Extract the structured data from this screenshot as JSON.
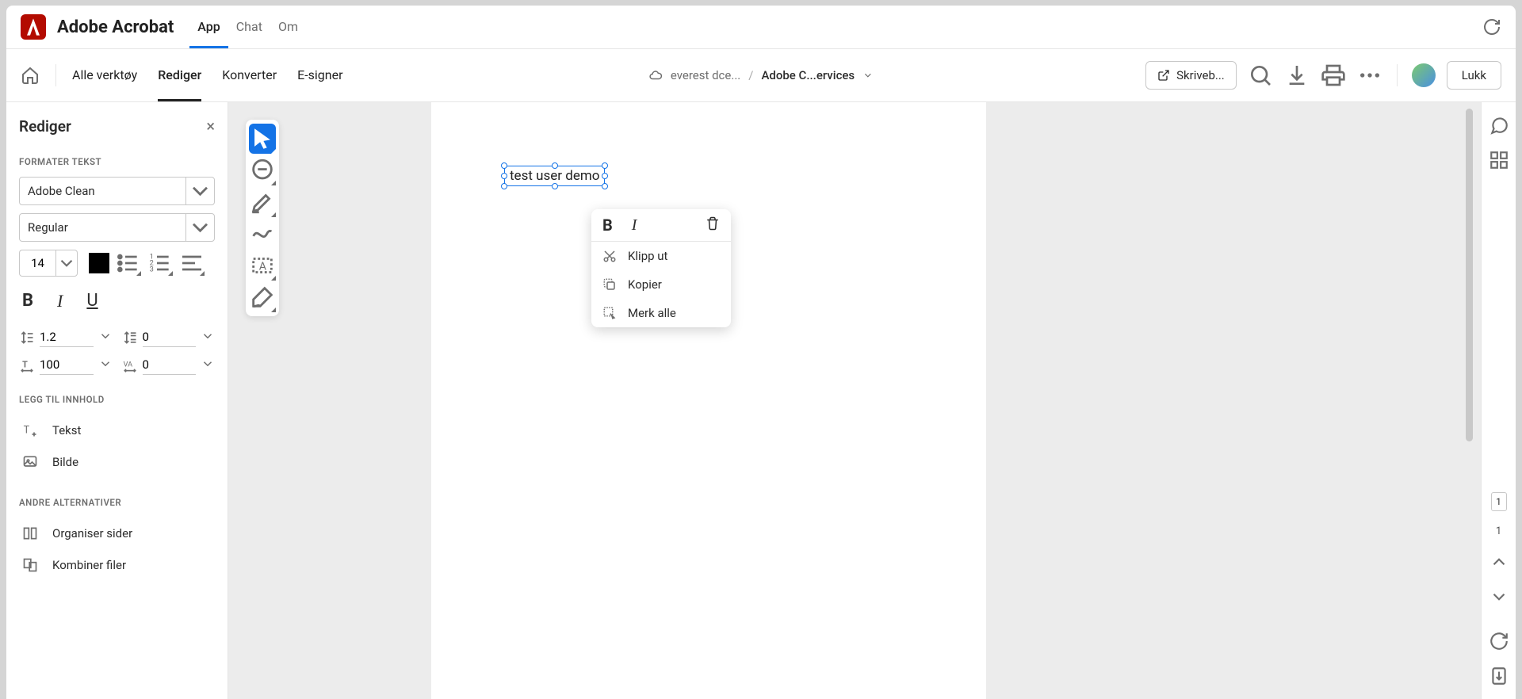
{
  "header": {
    "app_title": "Adobe Acrobat",
    "tabs": {
      "app": "App",
      "chat": "Chat",
      "about": "Om"
    }
  },
  "toolbar": {
    "tabs": {
      "all_tools": "Alle verktøy",
      "edit": "Rediger",
      "convert": "Konverter",
      "esign": "E-signer"
    },
    "breadcrumb": {
      "folder": "everest dce...",
      "sep": "/",
      "file": "Adobe C...ervices"
    },
    "desktop_label": "Skriveb...",
    "close_label": "Lukk"
  },
  "panel": {
    "title": "Rediger",
    "section_format": "FORMATER TEKST",
    "font_family": "Adobe Clean",
    "font_weight": "Regular",
    "font_size": "14",
    "line_height": "1.2",
    "para_spacing": "0",
    "h_scale": "100",
    "tracking": "0",
    "section_add": "LEGG TIL INNHOLD",
    "add_text": "Tekst",
    "add_image": "Bilde",
    "section_other": "ANDRE ALTERNATIVER",
    "organize": "Organiser sider",
    "combine": "Kombiner filer"
  },
  "canvas": {
    "selected_text": "test user demo"
  },
  "context_menu": {
    "cut": "Klipp ut",
    "copy": "Kopier",
    "select_all": "Merk alle"
  },
  "rail": {
    "page_current": "1",
    "page_total": "1"
  }
}
